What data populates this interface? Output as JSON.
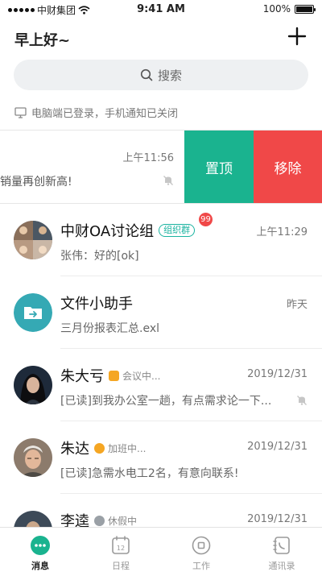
{
  "status_bar": {
    "carrier": "中财集团",
    "time": "9:41 AM",
    "battery": "100%",
    "battery_level": 1.0
  },
  "header": {
    "title": "早上好~"
  },
  "search": {
    "placeholder": "搜索"
  },
  "notice": {
    "text": "电脑端已登录，手机通知已关闭"
  },
  "swiped_row": {
    "time": "上午11:56",
    "preview": "销量再创新高!",
    "pin_label": "置顶",
    "remove_label": "移除"
  },
  "chats": [
    {
      "name": "中财OA讨论组",
      "tag": "组织群",
      "badge": "99",
      "time": "上午11:29",
      "preview": "张伟：好的[ok]"
    },
    {
      "name": "文件小助手",
      "time": "昨天",
      "preview": "三月份报表汇总.exl"
    },
    {
      "name": "朱大亏",
      "status": "会议中...",
      "time": "2019/12/31",
      "preview": "[已读]到我办公室一趟，有点需求论一下..."
    },
    {
      "name": "朱达",
      "status": "加班中...",
      "time": "2019/12/31",
      "preview": "[已读]急需水电工2名，有意向联系!"
    },
    {
      "name": "李逵",
      "status": "休假中",
      "time": "2019/12/31"
    }
  ],
  "tabs": [
    {
      "label": "消息",
      "icon": "chat-icon",
      "active": true
    },
    {
      "label": "日程",
      "icon": "calendar-icon",
      "active": false
    },
    {
      "label": "工作",
      "icon": "work-icon",
      "active": false
    },
    {
      "label": "通讯录",
      "icon": "contacts-icon",
      "active": false
    }
  ],
  "colors": {
    "accent": "#1ab38f",
    "danger": "#f04848",
    "folder": "#35a9b4",
    "status_orange": "#f5a623",
    "status_gray": "#9aa0a6"
  }
}
